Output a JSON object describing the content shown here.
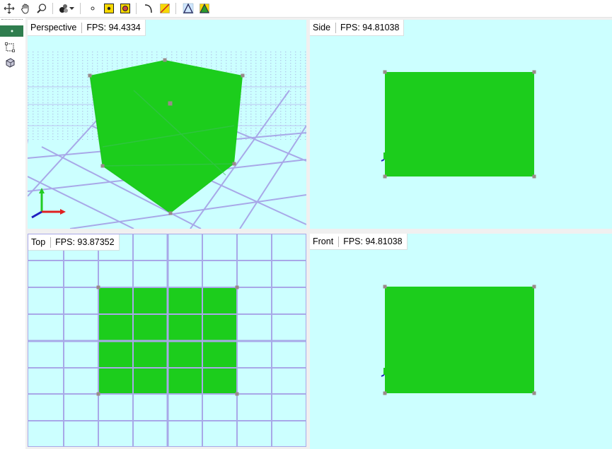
{
  "toolbar": {
    "tools": [
      {
        "name": "move-tool-icon"
      },
      {
        "name": "pan-hand-icon"
      },
      {
        "name": "zoom-icon"
      },
      {
        "name": "render-mode-icon"
      },
      {
        "name": "point-icon"
      },
      {
        "name": "vertex-select-icon"
      },
      {
        "name": "face-select-icon"
      },
      {
        "name": "curve-icon"
      },
      {
        "name": "line-icon"
      },
      {
        "name": "triangle-wire-icon"
      },
      {
        "name": "triangle-fill-icon"
      }
    ]
  },
  "viewports": {
    "perspective": {
      "name": "Perspective",
      "fps": "FPS: 94.4334"
    },
    "side": {
      "name": "Side",
      "fps": "FPS: 94.81038"
    },
    "top": {
      "name": "Top",
      "fps": "FPS: 93.87352"
    },
    "front": {
      "name": "Front",
      "fps": "FPS: 94.81038"
    }
  },
  "colors": {
    "viewport_bg": "#ccffff",
    "mesh": "#1ccd1c",
    "grid": "#a8a8e8",
    "vertex": "#9a8a8a",
    "active_tool": "#2f7d4e"
  }
}
